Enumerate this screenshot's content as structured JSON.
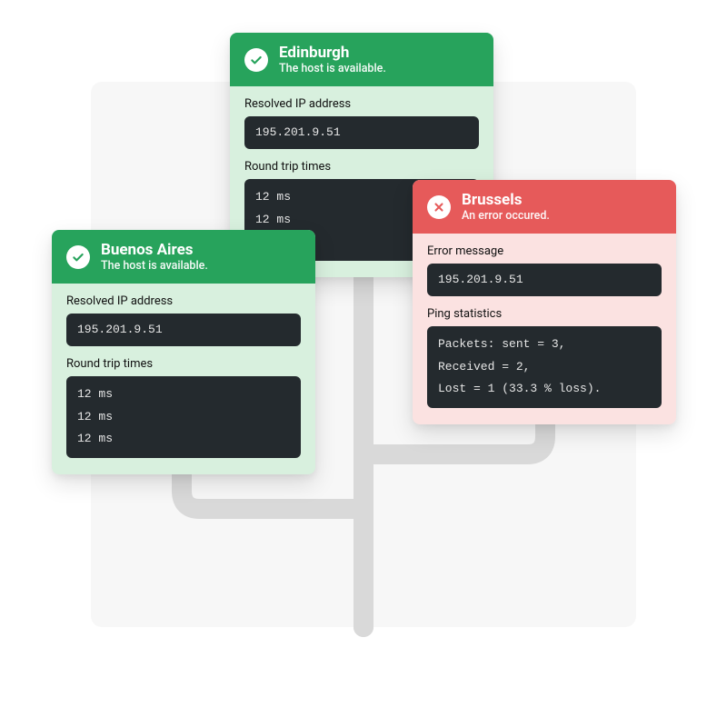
{
  "cards": {
    "edinburgh": {
      "title": "Edinburgh",
      "subtitle": "The host is available.",
      "ip_label": "Resolved IP address",
      "ip": "195.201.9.51",
      "rtt_label": "Round trip times",
      "rtt": "12 ms\n12 ms\n12 ms"
    },
    "brussels": {
      "title": "Brussels",
      "subtitle": "An error occured.",
      "err_label": "Error message",
      "err_value": "195.201.9.51",
      "stats_label": "Ping statistics",
      "stats": "Packets: sent = 3,\nReceived = 2,\nLost = 1 (33.3 % loss)."
    },
    "buenosaires": {
      "title": "Buenos Aires",
      "subtitle": "The host is available.",
      "ip_label": "Resolved IP address",
      "ip": "195.201.9.51",
      "rtt_label": "Round trip times",
      "rtt": "12 ms\n12 ms\n12 ms"
    }
  }
}
